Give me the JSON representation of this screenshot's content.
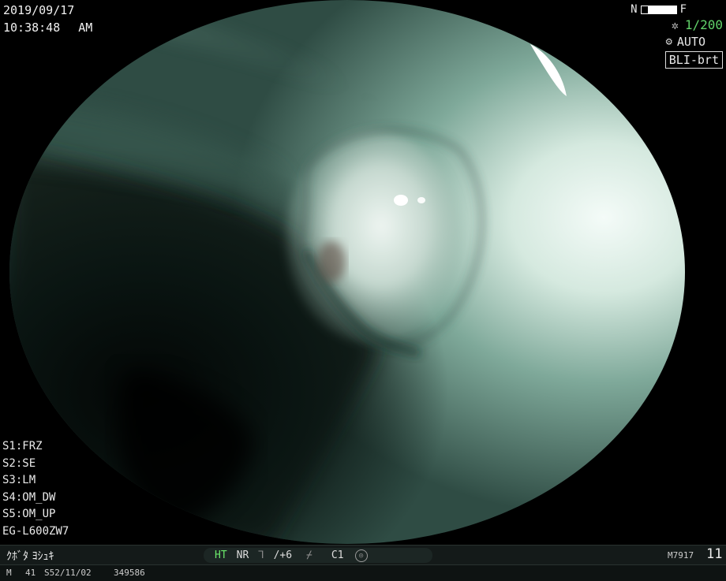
{
  "overlay": {
    "date": "2019/09/17",
    "time": "10:38:48",
    "ampm": "AM"
  },
  "camera": {
    "near_label": "N",
    "far_label": "F",
    "shutter_icon": "aperture-icon",
    "shutter": "1/200",
    "iris_icon": "iris-icon",
    "iris_mode": "AUTO",
    "light_mode": "BLI-brt"
  },
  "settings_list": [
    "S1:FRZ",
    "S2:SE",
    "S3:LM",
    "S4:OM_DW",
    "S5:OM_UP",
    "EG-L600ZW7"
  ],
  "status_bar": {
    "patient_name": "ｸﾎﾞﾀ ﾖｼｭｷ",
    "ht": "HT",
    "nr": "NR",
    "enhance_icon": "curve-icon",
    "enhance": "/+6",
    "color_icon": "tone-curve-icon",
    "color": "C1",
    "record_icon": "record-icon",
    "model_code": "M7917",
    "counter": "11"
  },
  "info_bar": {
    "sex": "M",
    "age": "41",
    "birth": "S52/11/02",
    "id": "349586"
  },
  "colors": {
    "mucosa_light": "#d9ece3",
    "mucosa_mid": "#6e9a8c",
    "mucosa_dark": "#0b1412",
    "indicator_green": "#62d36a"
  }
}
